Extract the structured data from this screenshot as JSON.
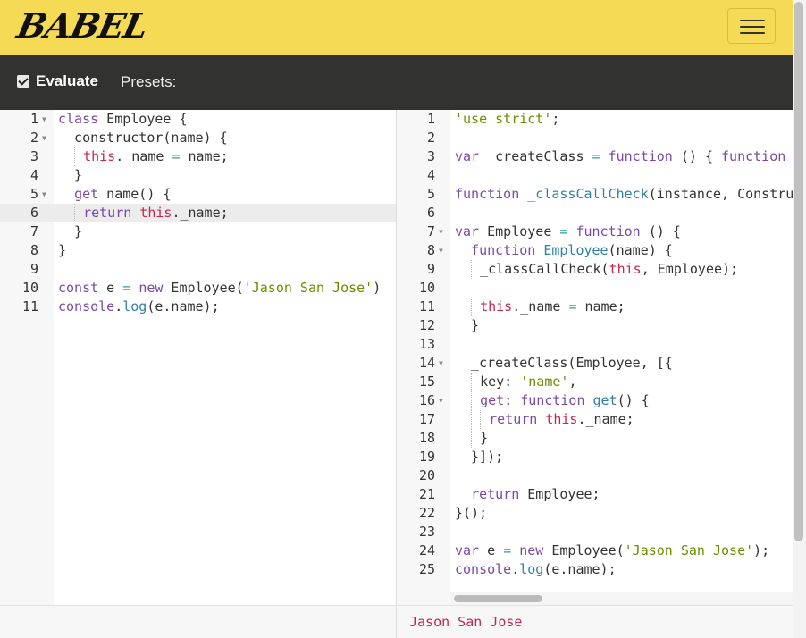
{
  "header": {
    "logo_text": "BABEL",
    "menu_icon": "hamburger-icon",
    "background_color": "#f5da55"
  },
  "toolbar": {
    "evaluate_label": "Evaluate",
    "evaluate_checked": true,
    "presets_label": "Presets:",
    "background_color": "#323330"
  },
  "input_editor": {
    "active_line": 6,
    "lines": [
      {
        "n": "1",
        "fold": true,
        "text": "class Employee {"
      },
      {
        "n": "2",
        "fold": true,
        "text": "  constructor(name) {"
      },
      {
        "n": "3",
        "fold": false,
        "text": "    this._name = name;"
      },
      {
        "n": "4",
        "fold": false,
        "text": "  }"
      },
      {
        "n": "5",
        "fold": true,
        "text": "  get name() {"
      },
      {
        "n": "6",
        "fold": false,
        "text": "    return this._name;"
      },
      {
        "n": "7",
        "fold": false,
        "text": "  }"
      },
      {
        "n": "8",
        "fold": false,
        "text": "}"
      },
      {
        "n": "9",
        "fold": false,
        "text": ""
      },
      {
        "n": "10",
        "fold": false,
        "text": "const e = new Employee('Jason San Jose')"
      },
      {
        "n": "11",
        "fold": false,
        "text": "console.log(e.name);"
      }
    ]
  },
  "output_editor": {
    "lines": [
      {
        "n": "1",
        "fold": false,
        "text": "'use strict';"
      },
      {
        "n": "2",
        "fold": false,
        "text": ""
      },
      {
        "n": "3",
        "fold": false,
        "text": "var _createClass = function () { function"
      },
      {
        "n": "4",
        "fold": false,
        "text": ""
      },
      {
        "n": "5",
        "fold": false,
        "text": "function _classCallCheck(instance, Constru"
      },
      {
        "n": "6",
        "fold": false,
        "text": ""
      },
      {
        "n": "7",
        "fold": true,
        "text": "var Employee = function () {"
      },
      {
        "n": "8",
        "fold": true,
        "text": "  function Employee(name) {"
      },
      {
        "n": "9",
        "fold": false,
        "text": "    _classCallCheck(this, Employee);"
      },
      {
        "n": "10",
        "fold": false,
        "text": ""
      },
      {
        "n": "11",
        "fold": false,
        "text": "    this._name = name;"
      },
      {
        "n": "12",
        "fold": false,
        "text": "  }"
      },
      {
        "n": "13",
        "fold": false,
        "text": ""
      },
      {
        "n": "14",
        "fold": true,
        "text": "  _createClass(Employee, [{"
      },
      {
        "n": "15",
        "fold": false,
        "text": "    key: 'name',"
      },
      {
        "n": "16",
        "fold": true,
        "text": "    get: function get() {"
      },
      {
        "n": "17",
        "fold": false,
        "text": "      return this._name;"
      },
      {
        "n": "18",
        "fold": false,
        "text": "    }"
      },
      {
        "n": "19",
        "fold": false,
        "text": "  }]);"
      },
      {
        "n": "20",
        "fold": false,
        "text": ""
      },
      {
        "n": "21",
        "fold": false,
        "text": "  return Employee;"
      },
      {
        "n": "22",
        "fold": false,
        "text": "}();"
      },
      {
        "n": "23",
        "fold": false,
        "text": ""
      },
      {
        "n": "24",
        "fold": false,
        "text": "var e = new Employee('Jason San Jose');"
      },
      {
        "n": "25",
        "fold": false,
        "text": "console.log(e.name);"
      }
    ]
  },
  "console_output": {
    "text": "Jason San Jose",
    "color": "#c7254e"
  },
  "syntax_colors": {
    "keyword": "#7a49a5",
    "this": "#c7254e",
    "function_name": "#2f7fa8",
    "string": "#6a8d00",
    "operator": "#2aa198",
    "param": "#e07b00"
  }
}
